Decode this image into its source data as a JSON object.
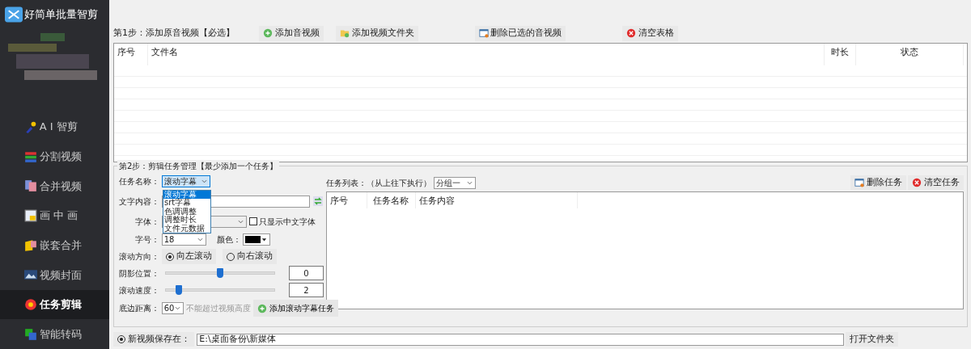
{
  "app": {
    "title": "好简单批量智剪"
  },
  "sidebar": {
    "items": [
      {
        "label": "A I 智剪",
        "kind": "ai",
        "selected": false
      },
      {
        "label": "分割视频",
        "kind": "split",
        "selected": false
      },
      {
        "label": "合并视频",
        "kind": "merge",
        "selected": false
      },
      {
        "label": "画 中 画",
        "kind": "pip",
        "selected": false
      },
      {
        "label": "嵌套合并",
        "kind": "nest",
        "selected": false
      },
      {
        "label": "视频封面",
        "kind": "cover",
        "selected": false
      },
      {
        "label": "任务剪辑",
        "kind": "task",
        "selected": true
      },
      {
        "label": "智能转码",
        "kind": "transcode",
        "selected": false
      }
    ]
  },
  "step1": {
    "title": "第1步：添加原音视频【必选】",
    "buttons": [
      {
        "label": "添加音视频",
        "kind": "add"
      },
      {
        "label": "添加视频文件夹",
        "kind": "folder"
      },
      {
        "label": "删除已选的音视频",
        "kind": "delete"
      },
      {
        "label": "清空表格",
        "kind": "clear"
      }
    ],
    "columns": [
      "序号",
      "文件名",
      "时长",
      "状态"
    ]
  },
  "step2": {
    "title": "第2步：剪辑任务管理【最少添加一个任务】",
    "task_name": {
      "label": "任务名称：",
      "value": "滚动字幕",
      "expanded": true,
      "options": [
        {
          "label": "滚动字幕",
          "selected": true
        },
        {
          "label": "srt字幕",
          "selected": false
        },
        {
          "label": "色调调整",
          "selected": false
        },
        {
          "label": "调整时长",
          "selected": false
        },
        {
          "label": "文件元数据",
          "selected": false
        }
      ]
    },
    "text_content": {
      "label": "文字内容："
    },
    "font": {
      "label": "字体："
    },
    "chinese_only": {
      "label": "只显示中文字体",
      "checked": false
    },
    "font_size": {
      "label": "字号：",
      "value": "18"
    },
    "color": {
      "label": "颜色："
    },
    "direction": {
      "label": "滚动方向：",
      "options": [
        {
          "label": "向左滚动",
          "selected": true
        },
        {
          "label": "向右滚动",
          "selected": false
        }
      ]
    },
    "sliders": [
      {
        "label": "阴影位置：",
        "level": 0.5,
        "reading": "0"
      },
      {
        "label": "滚动速度：",
        "level": 0.12,
        "reading": "2"
      }
    ],
    "bottom_margin": {
      "label": "底边距离：",
      "value": "60",
      "hint": "不能超过视频高度"
    },
    "add_button": "添加滚动字幕任务"
  },
  "task_list": {
    "label": "任务列表：（从上往下执行）",
    "group": "分组一",
    "buttons": [
      {
        "label": "删除任务",
        "kind": "delete"
      },
      {
        "label": "清空任务",
        "kind": "clear"
      }
    ],
    "columns": [
      "序号",
      "任务名称",
      "任务内容"
    ]
  },
  "output": {
    "label": "新视频保存在：",
    "selected": true,
    "path": "E:\\桌面备份\\新媒体",
    "button": "打开文件夹"
  }
}
